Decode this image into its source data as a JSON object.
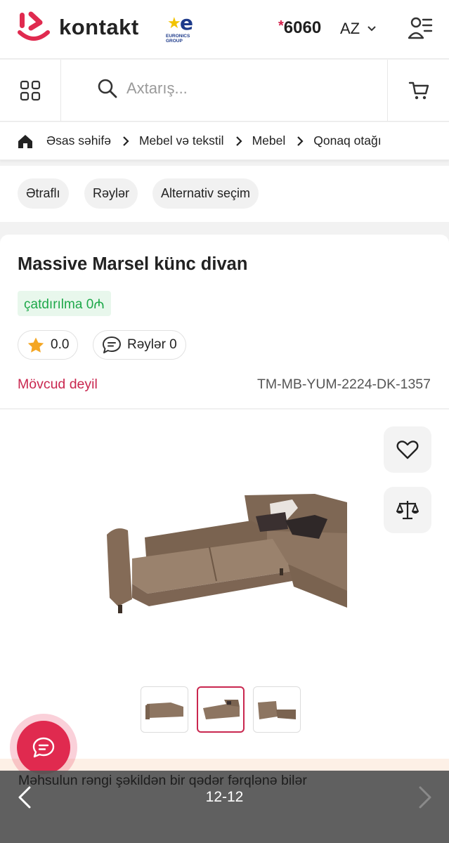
{
  "header": {
    "brand": "kontakt",
    "partner_label": "EURONICS GROUP",
    "phone_prefix": "*",
    "phone": "6060",
    "language": "AZ"
  },
  "search": {
    "placeholder": "Axtarış..."
  },
  "breadcrumb": [
    "Əsas səhifə",
    "Mebel və tekstil",
    "Mebel",
    "Qonaq otağı"
  ],
  "tabs": [
    "Ətraflı",
    "Rəylər",
    "Alternativ seçim"
  ],
  "product": {
    "title": "Massive Marsel künc divan",
    "delivery": "çatdırılma 0₼",
    "rating": "0.0",
    "reviews_label": "Rəylər 0",
    "availability": "Mövcud deyil",
    "sku": "TM-MB-YUM-2224-DK-1357"
  },
  "gallery": {
    "thumbnail_count": 3,
    "active_thumbnail": 2
  },
  "notice": "Məhsulun rəngi şəkildən bir qədər fərqlənə bilər",
  "viewer": {
    "pager": "12-12"
  },
  "colors": {
    "accent": "#e02a4f",
    "delivery_green": "#1ea84a",
    "unavailable": "#c9274f",
    "star": "#f4a623"
  },
  "icons": [
    "grid-icon",
    "search-icon",
    "cart-icon",
    "home-icon",
    "chevron-right-icon",
    "star-icon",
    "comment-icon",
    "heart-icon",
    "compare-icon",
    "chat-icon",
    "arrow-left-icon",
    "arrow-right-icon",
    "user-menu-icon",
    "chevron-down-icon"
  ]
}
